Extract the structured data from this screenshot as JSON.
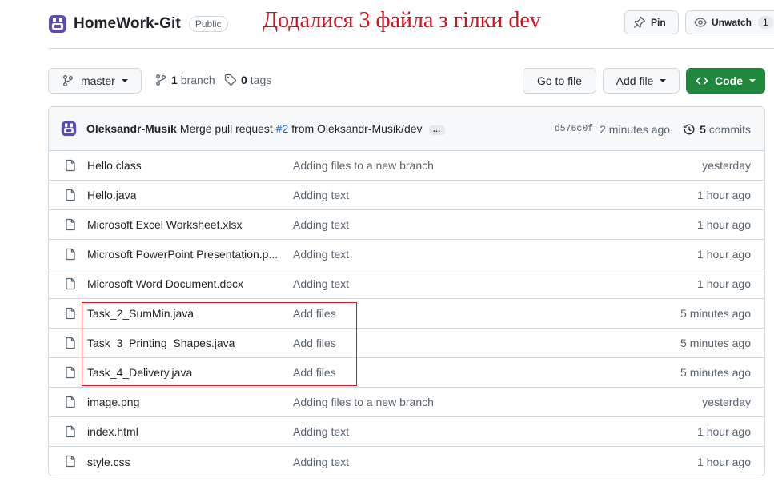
{
  "repo": {
    "name": "HomeWork-Git",
    "visibility": "Public"
  },
  "annotation": "Додалися 3 файла з гілки dev",
  "header_actions": {
    "pin_label": "Pin",
    "unwatch_label": "Unwatch",
    "watch_count": "1"
  },
  "toolbar": {
    "branch_label": "master",
    "branches_count": "1",
    "branches_label": "branch",
    "tags_count": "0",
    "tags_label": "tags",
    "goto_file_label": "Go to file",
    "add_file_label": "Add file",
    "code_label": "Code"
  },
  "last_commit": {
    "author": "Oleksandr-Musik",
    "message_prefix": "Merge pull request",
    "pr_number": "#2",
    "message_suffix": "from Oleksandr-Musik/dev",
    "ellipsis": "…",
    "sha": "d576c0f",
    "time": "2 minutes ago",
    "commits_count": "5",
    "commits_label": "commits"
  },
  "files": [
    {
      "name": "Hello.class",
      "message": "Adding files to a new branch",
      "time": "yesterday"
    },
    {
      "name": "Hello.java",
      "message": "Adding text",
      "time": "1 hour ago"
    },
    {
      "name": "Microsoft Excel Worksheet.xlsx",
      "message": "Adding text",
      "time": "1 hour ago"
    },
    {
      "name": "Microsoft PowerPoint Presentation.p...",
      "message": "Adding text",
      "time": "1 hour ago"
    },
    {
      "name": "Microsoft Word Document.docx",
      "message": "Adding text",
      "time": "1 hour ago"
    },
    {
      "name": "Task_2_SumMin.java",
      "message": "Add files",
      "time": "5 minutes ago"
    },
    {
      "name": "Task_3_Printing_Shapes.java",
      "message": "Add files",
      "time": "5 minutes ago"
    },
    {
      "name": "Task_4_Delivery.java",
      "message": "Add files",
      "time": "5 minutes ago"
    },
    {
      "name": "image.png",
      "message": "Adding files to a new branch",
      "time": "yesterday"
    },
    {
      "name": "index.html",
      "message": "Adding text",
      "time": "1 hour ago"
    },
    {
      "name": "style.css",
      "message": "Adding text",
      "time": "1 hour ago"
    }
  ],
  "colors": {
    "annotation_red": "#d6101c",
    "code_green": "#1f883d",
    "link_blue": "#0969da",
    "repo_icon_purple": "#5b4bb7"
  }
}
